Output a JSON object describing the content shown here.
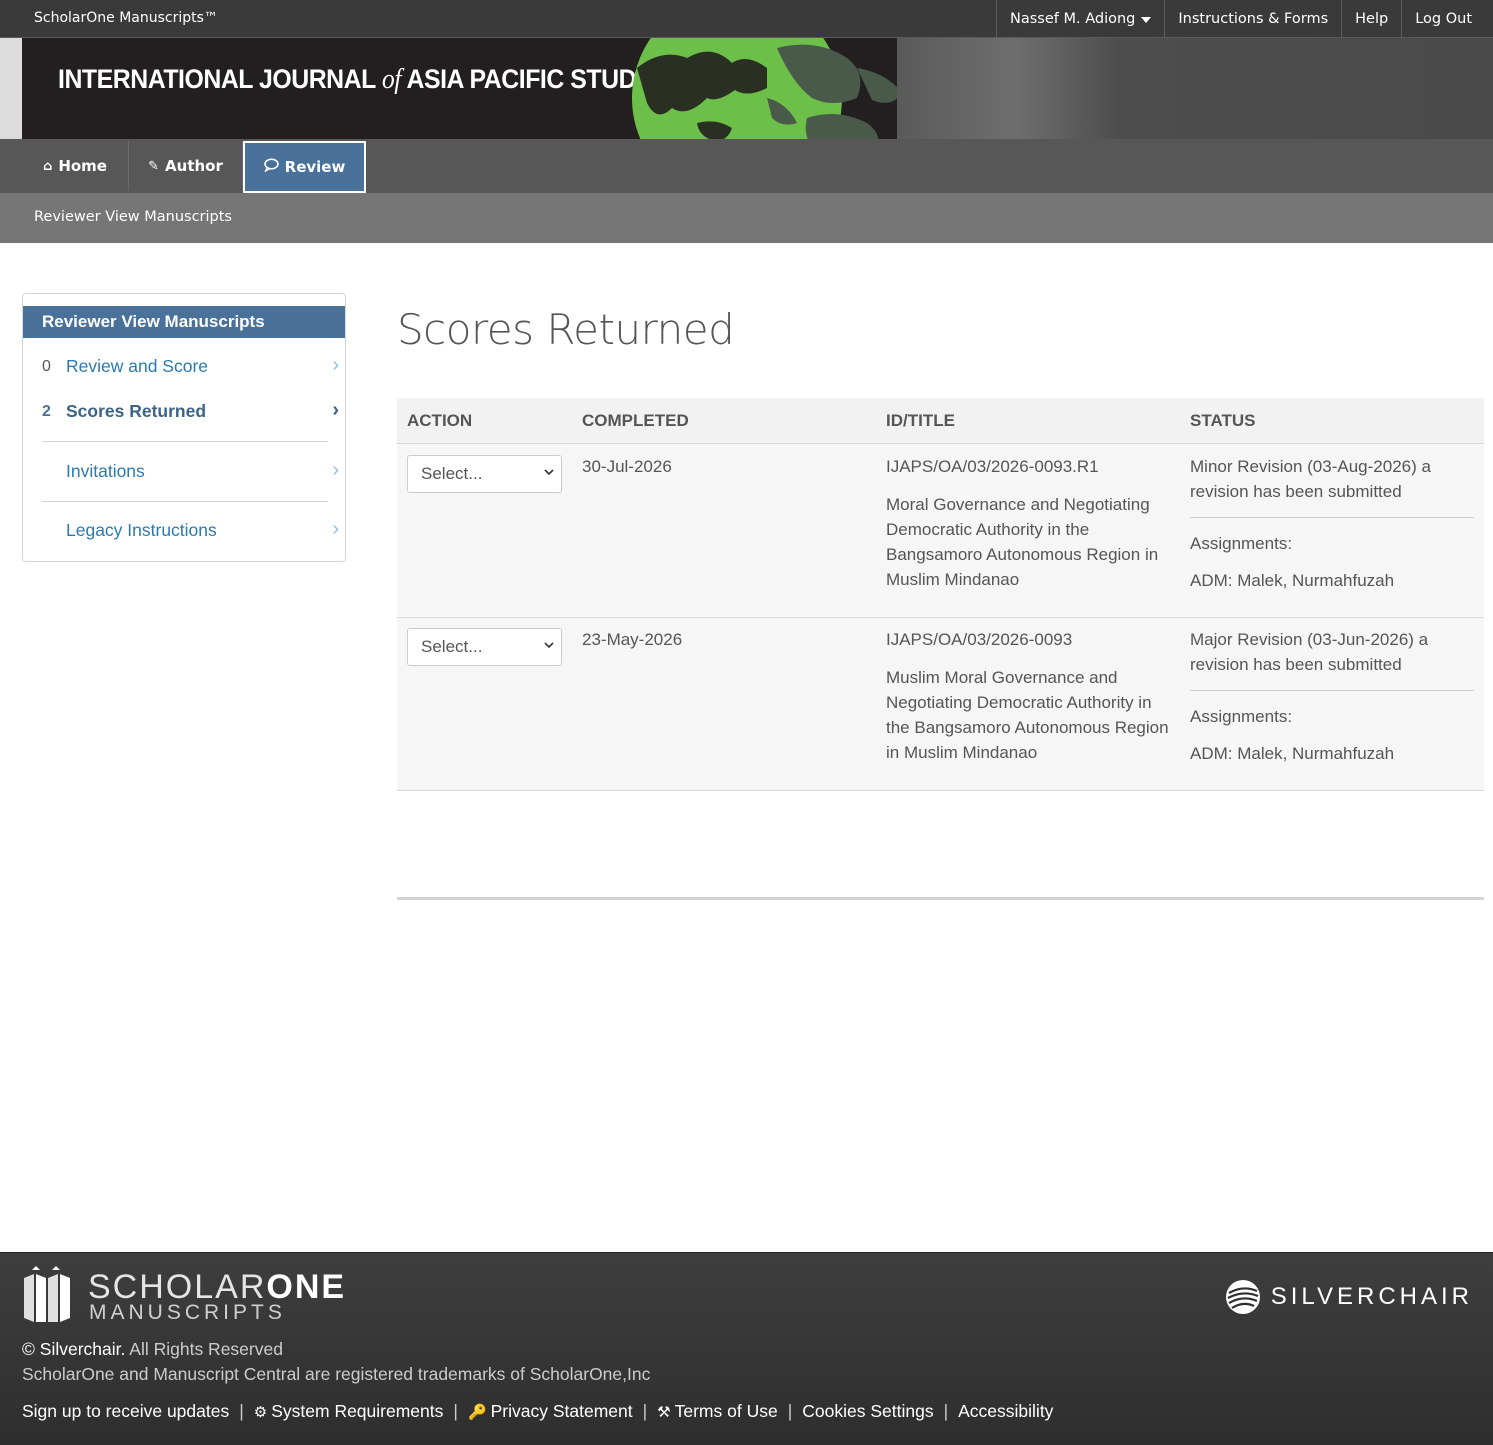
{
  "topbar": {
    "brand": "ScholarOne Manuscripts™",
    "user": "Nassef M. Adiong",
    "instructions": "Instructions & Forms",
    "help": "Help",
    "logout": "Log Out"
  },
  "banner": {
    "title_part1": "INTERNATIONAL JOURNAL",
    "title_of": "of",
    "title_part2": "ASIA PACIFIC STUDIES"
  },
  "nav": {
    "home": "Home",
    "author": "Author",
    "review": "Review",
    "home_icon": "home-icon",
    "author_icon": "pencil-icon",
    "review_icon": "speech-bubble-icon"
  },
  "breadcrumb": "Reviewer View Manuscripts",
  "sidebar": {
    "heading": "Reviewer View Manuscripts",
    "items": [
      {
        "count": "0",
        "label": "Review and Score"
      },
      {
        "count": "2",
        "label": "Scores Returned"
      },
      {
        "count": "",
        "label": "Invitations"
      },
      {
        "count": "",
        "label": "Legacy Instructions"
      }
    ]
  },
  "main": {
    "title": "Scores Returned",
    "columns": [
      "ACTION",
      "COMPLETED",
      "ID/TITLE",
      "STATUS"
    ],
    "rows": [
      {
        "action": "Select...",
        "completed": "30-Jul-2026",
        "id": "IJAPS/OA/03/2026-0093.R1",
        "title": "Moral Governance and Negotiating Democratic Authority in the Bangsamoro Autonomous Region in Muslim Mindanao",
        "status": "Minor Revision (03-Aug-2026) a revision has been submitted",
        "assignments_label": "Assignments:",
        "assignment": "ADM: Malek, Nurmahfuzah"
      },
      {
        "action": "Select...",
        "completed": "23-May-2026",
        "id": "IJAPS/OA/03/2026-0093",
        "title": "Muslim Moral Governance and Negotiating Democratic Authority in the Bangsamoro Autonomous Region in Muslim Mindanao",
        "status": "Major Revision (03-Jun-2026) a revision has been submitted",
        "assignments_label": "Assignments:",
        "assignment": "ADM: Malek, Nurmahfuzah"
      }
    ]
  },
  "footer": {
    "scholarone_1": "SCHOLAR",
    "scholarone_2": "ONE",
    "manuscripts": "MANUSCRIPTS",
    "silverchair": "SILVERCHAIR",
    "copyright_symbol": "©",
    "copyright_company": "Silverchair.",
    "copyright_rest": "All Rights Reserved",
    "trademark": "ScholarOne and Manuscript Central are registered trademarks of ScholarOne,Inc",
    "links": {
      "signup": "Sign up to receive updates",
      "sysreq": "System Requirements",
      "privacy": "Privacy Statement",
      "terms": "Terms of Use",
      "cookies": "Cookies Settings",
      "accessibility": "Accessibility"
    },
    "separator": "|"
  },
  "colors": {
    "accent": "#4a7199",
    "link": "#2a7ab0",
    "topbar": "#3a3a3a",
    "nav": "#575757"
  }
}
